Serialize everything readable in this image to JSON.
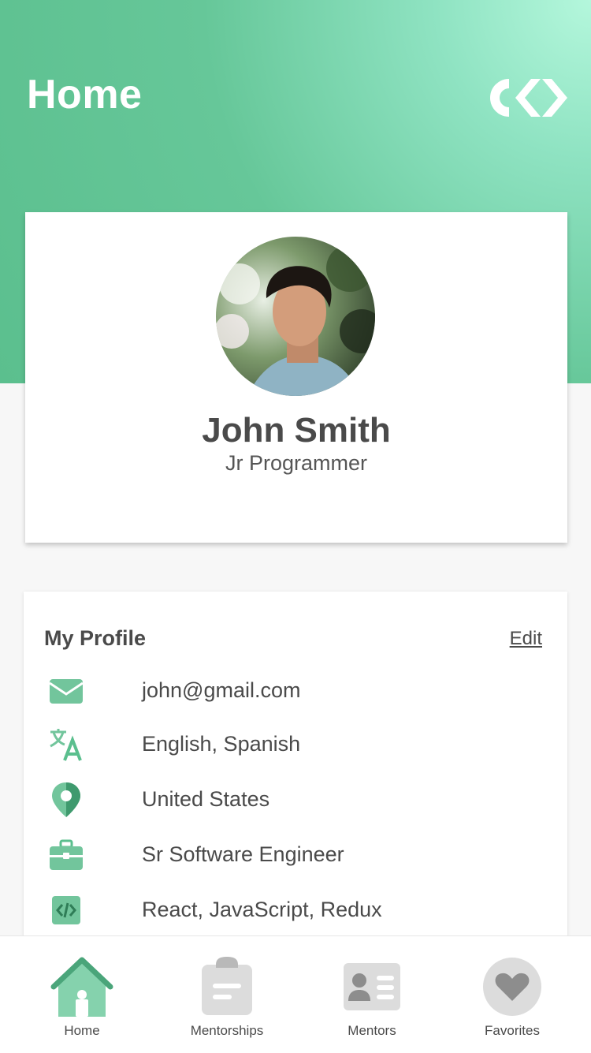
{
  "header": {
    "title": "Home",
    "logo_icon": "brand-logo-icon"
  },
  "profile": {
    "name": "John Smith",
    "role": "Jr Programmer",
    "avatar_icon": "avatar-photo"
  },
  "details": {
    "title": "My Profile",
    "edit_label": "Edit",
    "items": [
      {
        "icon": "mail-icon",
        "text": "john@gmail.com"
      },
      {
        "icon": "translate-icon",
        "text": "English, Spanish"
      },
      {
        "icon": "location-pin-icon",
        "text": "United States"
      },
      {
        "icon": "briefcase-icon",
        "text": "Sr Software Engineer"
      },
      {
        "icon": "code-icon",
        "text": "React, JavaScript, Redux"
      }
    ]
  },
  "nav": {
    "items": [
      {
        "label": "Home",
        "icon": "home-icon",
        "active": true
      },
      {
        "label": "Mentorships",
        "icon": "clipboard-icon",
        "active": false
      },
      {
        "label": "Mentors",
        "icon": "contact-card-icon",
        "active": false
      },
      {
        "label": "Favorites",
        "icon": "heart-icon",
        "active": false
      }
    ]
  },
  "colors": {
    "accent": "#5bbf8e",
    "accent_light": "#8fe3c2",
    "accent_dark": "#3f9a6e",
    "inactive_icon": "#cfcfcf",
    "text": "#4a4a4a"
  }
}
